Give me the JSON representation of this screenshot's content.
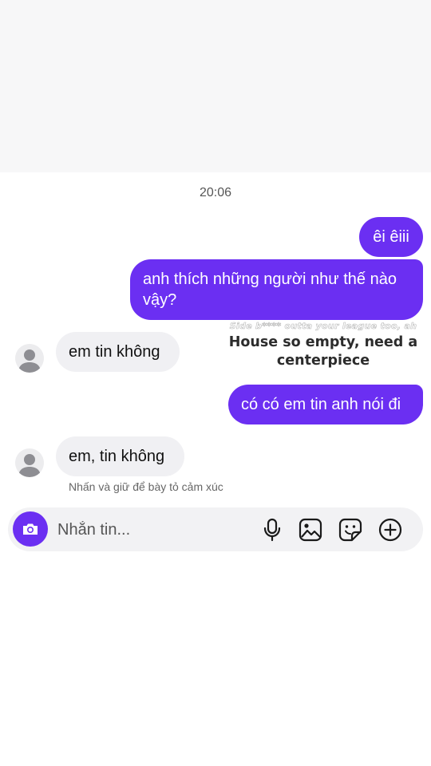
{
  "colors": {
    "accent": "#6b2ff2",
    "incoming_bubble": "#f0f0f3"
  },
  "thread": {
    "timestamp": "20:06",
    "messages": [
      {
        "side": "outgoing",
        "text": "êi êiii"
      },
      {
        "side": "outgoing",
        "text": "anh thích những người như thế nào vậy?"
      },
      {
        "side": "incoming",
        "text": "em tin không"
      },
      {
        "side": "outgoing",
        "text": "có có em tin anh nói đi"
      },
      {
        "side": "incoming",
        "text": "em, tin không"
      }
    ],
    "sticker": {
      "small_text": "Side b**** outta your league too, ah",
      "big_text": "House so empty, need a centerpiece"
    },
    "reaction_hint": "Nhấn và giữ để bày tỏ cảm xúc"
  },
  "composer": {
    "placeholder": "Nhắn tin...",
    "icons": [
      "camera-icon",
      "microphone-icon",
      "image-icon",
      "sticker-icon",
      "plus-circle-icon"
    ]
  }
}
